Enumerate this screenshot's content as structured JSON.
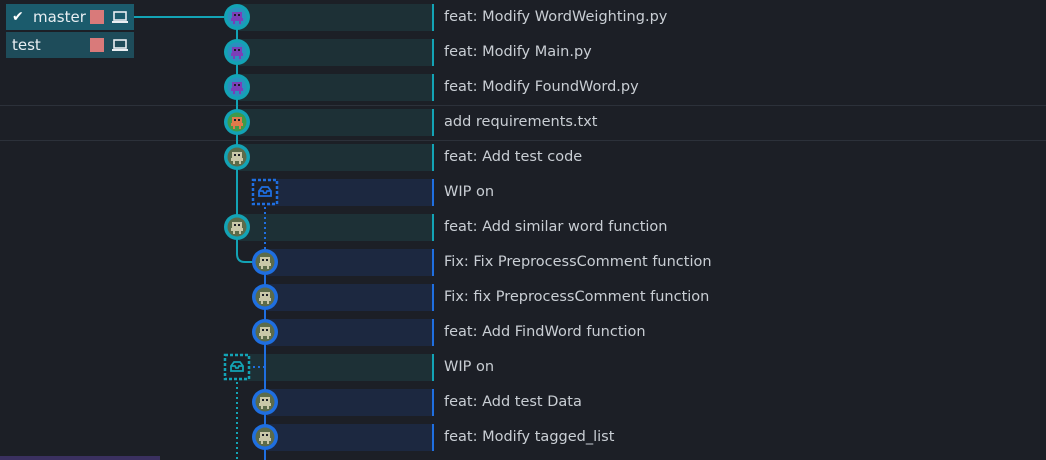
{
  "branches": [
    {
      "name": "master",
      "checked": true,
      "avatar_color": "#e07d7d"
    },
    {
      "name": "test",
      "checked": false,
      "avatar_color": "#e07d7d"
    }
  ],
  "commits": [
    {
      "message": "feat: Modify WordWeighting.py",
      "lane": 0,
      "avatar": "purple-robot-icon",
      "accent": "#13a3b5"
    },
    {
      "message": "feat: Modify Main.py",
      "lane": 0,
      "avatar": "purple-robot-icon",
      "accent": "#13a3b5"
    },
    {
      "message": "feat: Modify FoundWord.py",
      "lane": 0,
      "avatar": "purple-robot-icon",
      "accent": "#13a3b5"
    },
    {
      "message": "add requirements.txt",
      "lane": 0,
      "avatar": "orange-robot-icon",
      "accent": "#13a3b5"
    },
    {
      "message": "feat: Add test code",
      "lane": 0,
      "avatar": "olive-robot-icon",
      "accent": "#13a3b5"
    },
    {
      "message": "WIP on",
      "lane": 1,
      "avatar": "stash-icon",
      "accent": "#1f6fe0"
    },
    {
      "message": "feat: Add similar word function",
      "lane": 0,
      "avatar": "olive-robot-icon",
      "accent": "#13a3b5"
    },
    {
      "message": "Fix: Fix PreprocessComment function",
      "lane": 1,
      "avatar": "olive-robot-icon",
      "accent": "#1f6fe0"
    },
    {
      "message": "Fix: fix PreprocessComment function",
      "lane": 1,
      "avatar": "olive-robot-icon",
      "accent": "#1f6fe0"
    },
    {
      "message": "feat: Add FindWord function",
      "lane": 1,
      "avatar": "olive-robot-icon",
      "accent": "#1f6fe0"
    },
    {
      "message": "WIP on",
      "lane": 0,
      "avatar": "stash-icon",
      "accent": "#13a3b5"
    },
    {
      "message": "feat: Add test Data",
      "lane": 1,
      "avatar": "olive-robot-icon",
      "accent": "#1f6fe0"
    },
    {
      "message": "feat: Modify tagged_list",
      "lane": 1,
      "avatar": "olive-robot-icon",
      "accent": "#1f6fe0"
    }
  ],
  "colors": {
    "lane0": "#13a3b5",
    "lane1": "#1f6fe0",
    "band_lane0": "#1d3036",
    "band_lane1": "#1c2840"
  }
}
